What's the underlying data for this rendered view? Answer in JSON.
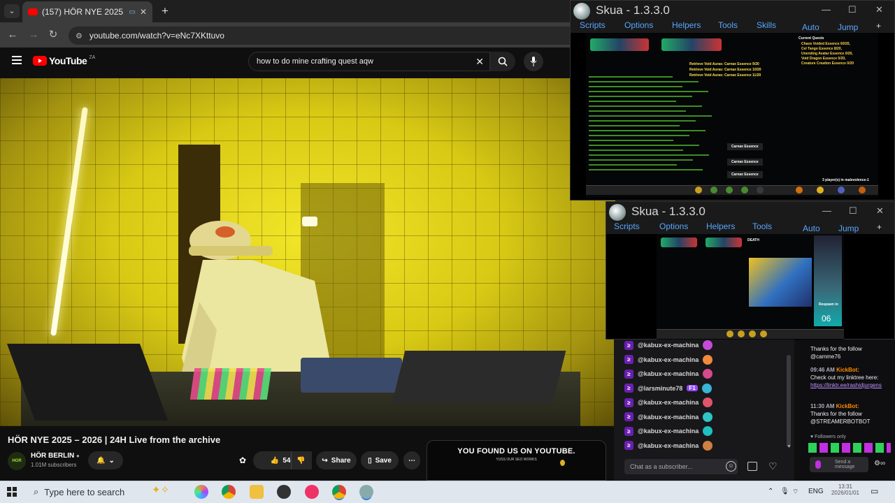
{
  "browser": {
    "tab_title": "(157) HÖR NYE 2025 – 2026",
    "url": "youtube.com/watch?v=eNc7XKttuvo"
  },
  "youtube": {
    "logo_text": "YouTube",
    "region": "ZA",
    "search_query": "how to do mine crafting quest aqw",
    "video_title": "HÖR NYE 2025 – 2026 | 24H Live from the archive",
    "channel_name": "HÖR BERLIN",
    "channel_avatar_text": "HOR",
    "subscribers": "1.01M subscribers",
    "likes": "540",
    "share_label": "Share",
    "save_label": "Save",
    "promo_title": "YOU FOUND US ON YOUTUBE.",
    "promo_sub": "YUSS OUR SEO WORKS",
    "accent": "#ff0000"
  },
  "skua1": {
    "title": "Skua - 1.3.3.0",
    "menu": [
      "Scripts",
      "Options",
      "Helpers",
      "Tools",
      "Skills",
      "Auto",
      "Jump"
    ],
    "quest_header": "Current Quests",
    "quest_lines": [
      "Chaos Voided Essence 60/20,",
      "Cel Tango Essence 8/20,",
      "Unending Avatar Essence 0/20,",
      "Void Dragon Essence 0/20,",
      "Creature Creation Essence 0/20"
    ],
    "overlay": [
      "Retrieve Void Auras: Carnax Essence 9/20",
      "Retrieve Void Auras: Carnax Essence 10/20",
      "Retrieve Void Auras: Carnax Essence 11/20"
    ],
    "drops": [
      "Carnax Essence",
      "Carnax Essence",
      "Carnax Essence"
    ],
    "player_count": "3 player(s) in malevolence-1"
  },
  "skua2": {
    "title": "Skua - 1.3.3.0",
    "menu": [
      "Scripts",
      "Options",
      "Helpers",
      "Tools",
      "Auto",
      "Jump"
    ],
    "death_label": "DEATH",
    "respawn_label": "Respawn in",
    "respawn_count": "06"
  },
  "chat": {
    "rows": [
      {
        "user": "@kabux-ex-machina",
        "emote": "#c54bd6"
      },
      {
        "user": "@kabux-ex-machina",
        "emote": "#f08a3c"
      },
      {
        "user": "@kabux-ex-machina",
        "emote": "#d44a8c"
      },
      {
        "user": "@larsminute78",
        "emote": "#39b3d6",
        "badge": "F1"
      },
      {
        "user": "@kabux-ex-machina",
        "emote": "#e0556a"
      },
      {
        "user": "@kabux-ex-machina",
        "emote": "#2fc5c5"
      },
      {
        "user": "@kabux-ex-machina",
        "emote": "#20c0c0"
      },
      {
        "user": "@kabux-ex-machina",
        "emote": "#d08040"
      }
    ],
    "placeholder": "Chat as a subscriber..."
  },
  "sidechat": {
    "msg1_tail": "Thanks for the follow @camme76",
    "msg2_time": "09:46 AM",
    "msg2_bot": "KickBot:",
    "msg2_text": "Check out my linktree here:",
    "msg2_link": "https://linktr.ee/rashidjurgens",
    "msg3_time": "11:30 AM",
    "msg3_bot": "KickBot:",
    "msg3_text": "Thanks for the follow @STREAMERBOTBOT",
    "followers_only": "Followers only",
    "send_label": "Send a message"
  },
  "taskbar": {
    "search_placeholder": "Type here to search",
    "lang": "ENG",
    "time": "13:31",
    "date": "2026/01/01"
  }
}
